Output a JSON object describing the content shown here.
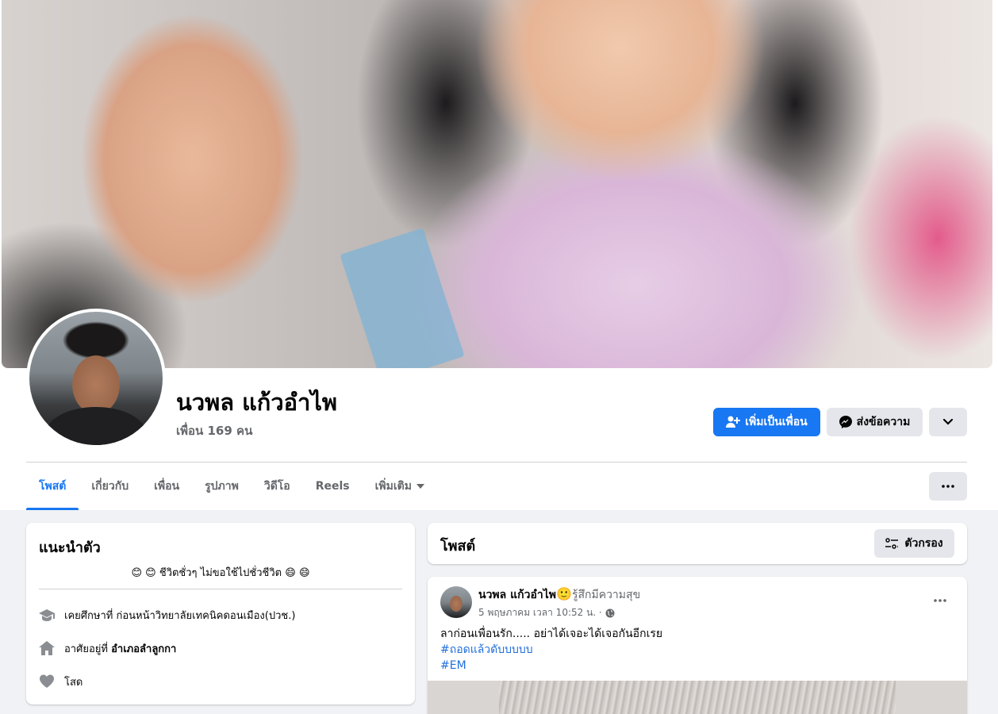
{
  "profile": {
    "name": "นวพล แก้วอำไพ",
    "friends": "เพื่อน 169 คน"
  },
  "actions": {
    "add_friend": "เพิ่มเป็นเพื่อน",
    "message": "ส่งข้อความ"
  },
  "tabs": [
    {
      "label": "โพสต์",
      "active": true
    },
    {
      "label": "เกี่ยวกับ"
    },
    {
      "label": "เพื่อน"
    },
    {
      "label": "รูปภาพ"
    },
    {
      "label": "วิดีโอ"
    },
    {
      "label": "Reels"
    },
    {
      "label": "เพิ่มเติม"
    }
  ],
  "intro": {
    "title": "แนะนำตัว",
    "bio": "😊 😊 ชีวิตชั่วๆ ไม่ขอใช้ไปชั่วชีวิต 😄 😄",
    "education_prefix": "เคยศึกษาที่",
    "education_value": "ก่อนหน้าวิทยาลัยเทคนิคดอนเมือง(ปวช.)",
    "lives_prefix": "อาศัยอยู่ที่",
    "lives_value": "อำเภอลำลูกกา",
    "relationship": "โสด"
  },
  "posts_header": {
    "title": "โพสต์",
    "filter": "ตัวกรอง"
  },
  "post": {
    "author": "นวพล แก้วอำไพ",
    "feeling_emoji": "🙂",
    "feeling": "รู้สึกมีความสุข",
    "time": "5 พฤษภาคม เวลา 10:52 น. ·",
    "text": "ลาก่อนเพื่อนรัก..... อย่าได้เจอะได้เจอกันอีกเรย",
    "hashtag1": "#ถอดแล้วดับบบบบ",
    "hashtag2": "#EM"
  },
  "colors": {
    "primary": "#1877f2",
    "background": "#f0f2f5",
    "secondary_text": "#65676b",
    "button_gray": "#e4e6eb"
  }
}
